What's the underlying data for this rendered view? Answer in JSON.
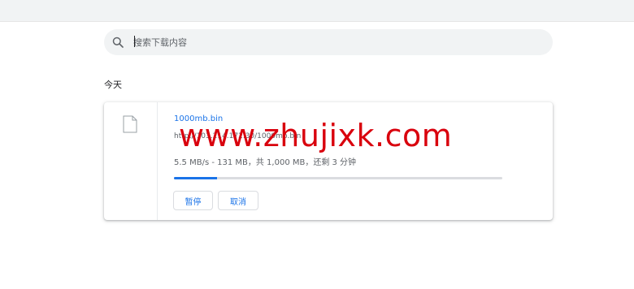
{
  "search": {
    "placeholder": "搜索下载内容"
  },
  "section": {
    "label": "今天"
  },
  "download": {
    "file_name": "1000mb.bin",
    "url": "http://103.214.172.30/1000mb.bin",
    "status": "5.5 MB/s - 131 MB，共 1,000 MB，还剩 3 分钟",
    "progress_fraction": 0.131,
    "pause_label": "暂停",
    "cancel_label": "取消"
  },
  "watermark": {
    "text": "www.zhujixk.com"
  },
  "colors": {
    "accent": "#1a73e8",
    "watermark": "#d9000d"
  },
  "icons": {
    "search": "search-icon",
    "file": "file-icon"
  }
}
